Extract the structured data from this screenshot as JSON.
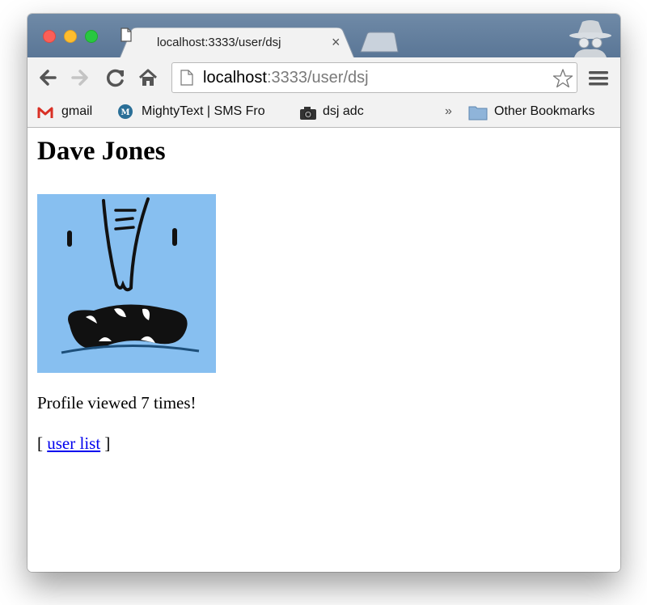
{
  "browser": {
    "tab_title": "localhost:3333/user/dsj",
    "tab_close": "×",
    "url_host": "localhost",
    "url_rest": ":3333/user/dsj",
    "bookmarks": [
      {
        "label": "gmail",
        "icon": "gmail-icon"
      },
      {
        "label": "MightyText | SMS Fro",
        "icon": "mightytext-icon"
      },
      {
        "label": "dsj adc",
        "icon": "camera-icon"
      }
    ],
    "overflow": "»",
    "other_bookmarks": "Other Bookmarks"
  },
  "page": {
    "heading": "Dave Jones",
    "views_text": "Profile viewed 7 times!",
    "list_open": "[",
    "list_link": "user list",
    "list_close": "]"
  },
  "colors": {
    "titlebar": "#5f7b9a",
    "toolbar": "#f2f2f2",
    "avatar_bg": "#87bff0",
    "link": "#0000ee"
  }
}
